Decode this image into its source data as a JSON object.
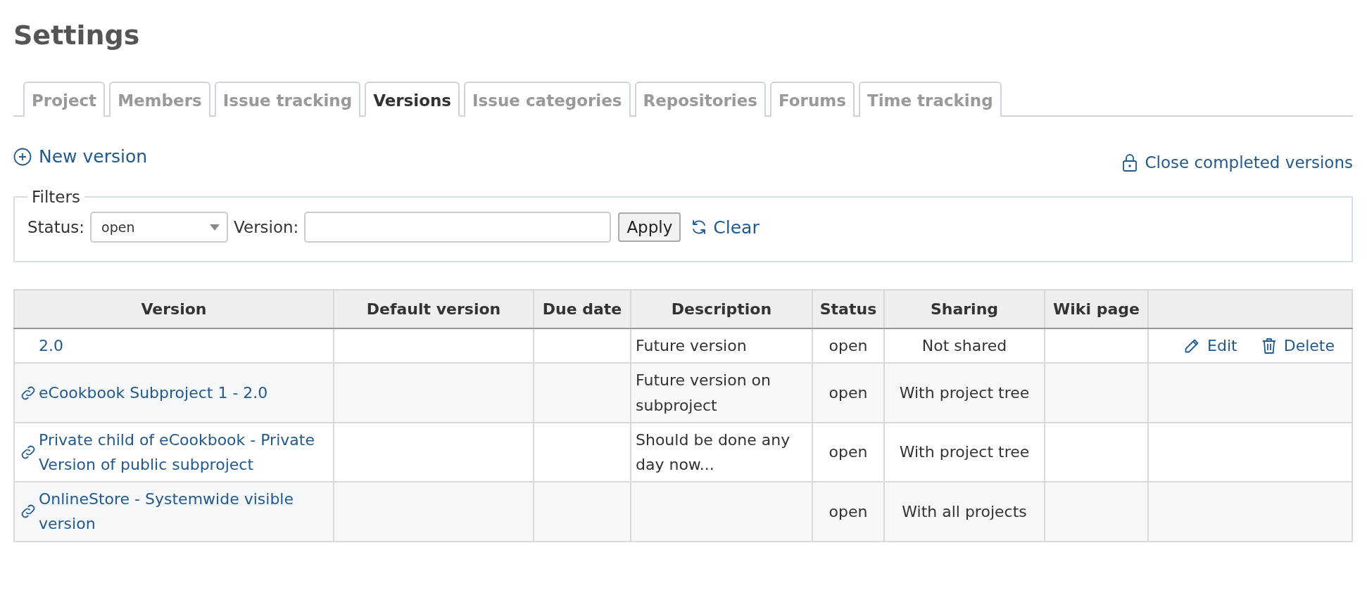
{
  "title": "Settings",
  "tabs": [
    {
      "label": "Project",
      "selected": false
    },
    {
      "label": "Members",
      "selected": false
    },
    {
      "label": "Issue tracking",
      "selected": false
    },
    {
      "label": "Versions",
      "selected": true
    },
    {
      "label": "Issue categories",
      "selected": false
    },
    {
      "label": "Repositories",
      "selected": false
    },
    {
      "label": "Forums",
      "selected": false
    },
    {
      "label": "Time tracking",
      "selected": false
    }
  ],
  "new_version_link": "New version",
  "close_completed_link": "Close completed versions",
  "filters": {
    "legend": "Filters",
    "status_label": "Status:",
    "status_value": "open",
    "version_label": "Version:",
    "apply_button": "Apply",
    "clear_link": "Clear"
  },
  "table": {
    "columns": [
      "Version",
      "Default version",
      "Due date",
      "Description",
      "Status",
      "Sharing",
      "Wiki page"
    ],
    "rows": [
      {
        "version": "2.0",
        "shared": false,
        "description": "Future version",
        "status": "open",
        "sharing": "Not shared",
        "actions": [
          {
            "kind": "edit",
            "label": "Edit"
          },
          {
            "kind": "delete",
            "label": "Delete"
          }
        ]
      },
      {
        "version": "eCookbook Subproject 1 - 2.0",
        "shared": true,
        "description": "Future version on subproject",
        "status": "open",
        "sharing": "With project tree",
        "actions": []
      },
      {
        "version": "Private child of eCookbook - Private Version of public subproject",
        "shared": true,
        "description": "Should be done any day now...",
        "status": "open",
        "sharing": "With project tree",
        "actions": []
      },
      {
        "version": "OnlineStore - Systemwide visible version",
        "shared": true,
        "description": "",
        "status": "open",
        "sharing": "With all projects",
        "actions": []
      }
    ]
  }
}
